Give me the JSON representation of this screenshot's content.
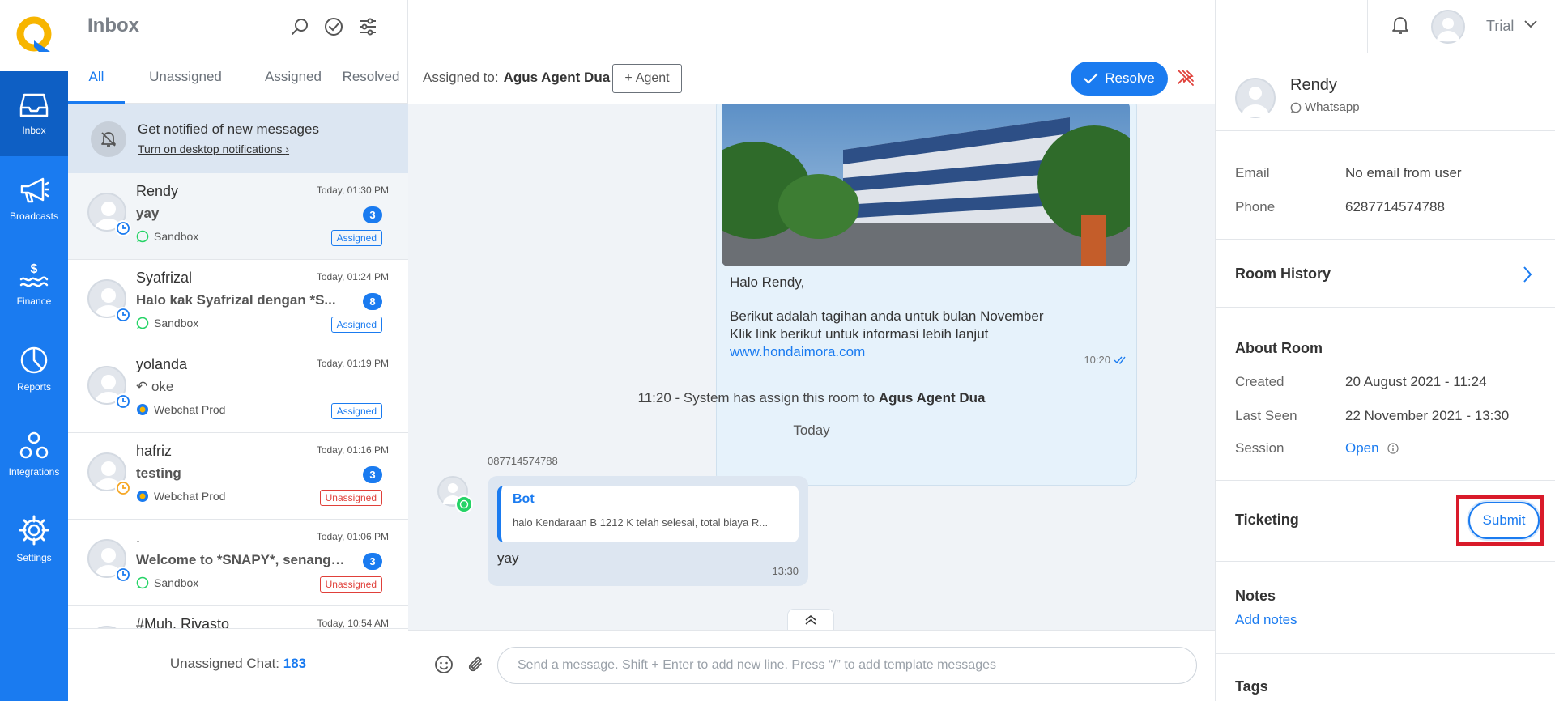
{
  "nav": {
    "items": [
      {
        "label": "Inbox",
        "icon": "inbox-icon"
      },
      {
        "label": "Broadcasts",
        "icon": "megaphone-icon"
      },
      {
        "label": "Finance",
        "icon": "finance-icon"
      },
      {
        "label": "Reports",
        "icon": "pie-chart-icon"
      },
      {
        "label": "Integrations",
        "icon": "integrations-icon"
      },
      {
        "label": "Settings",
        "icon": "gear-icon"
      }
    ],
    "colors": {
      "primary": "#1a7bf0",
      "active": "#0e5fc4",
      "logo_yellow": "#f7b500"
    }
  },
  "list": {
    "title": "Inbox",
    "tabs": [
      "All",
      "Unassigned",
      "Assigned",
      "Resolved"
    ],
    "active_tab": "All",
    "notification": {
      "title": "Get notified of new messages",
      "link": "Turn on desktop notifications"
    },
    "conversations": [
      {
        "name": "Rendy",
        "time": "Today, 01:30 PM",
        "message": "yay",
        "count": "3",
        "channel": "Sandbox",
        "channel_type": "whatsapp",
        "status": "Assigned",
        "clock_color": "#1a7bf0"
      },
      {
        "name": "Syafrizal",
        "time": "Today, 01:24 PM",
        "message": "Halo kak Syafrizal dengan *S...",
        "count": "8",
        "channel": "Sandbox",
        "channel_type": "whatsapp",
        "status": "Assigned",
        "clock_color": "#1a7bf0"
      },
      {
        "name": "yolanda",
        "time": "Today, 01:19 PM",
        "message": "oke",
        "count": "",
        "channel": "Webchat Prod",
        "channel_type": "webchat",
        "status": "Assigned",
        "clock_color": "#1a7bf0"
      },
      {
        "name": "hafriz",
        "time": "Today, 01:16 PM",
        "message": "testing",
        "count": "3",
        "channel": "Webchat Prod",
        "channel_type": "webchat",
        "status": "Unassigned",
        "clock_color": "#f5a623"
      },
      {
        "name": ".",
        "time": "Today, 01:06 PM",
        "message": "Welcome to *SNAPY*, senang d...",
        "count": "3",
        "channel": "Sandbox",
        "channel_type": "whatsapp",
        "status": "Unassigned",
        "clock_color": "#1a7bf0"
      },
      {
        "name": "#Muh. Rivasto",
        "time": "Today, 10:54 AM",
        "message": "",
        "count": "",
        "channel": "",
        "channel_type": "",
        "status": "",
        "clock_color": "#1a7bf0"
      }
    ],
    "footer_label": "Unassigned Chat:",
    "footer_count": "183"
  },
  "chat": {
    "assigned_label": "Assigned to:",
    "assigned_agent": "Agus Agent Dua",
    "agent_button": "Agent",
    "resolve_button": "Resolve",
    "outgoing": {
      "greeting": "Halo Rendy,",
      "line1": "Berikut adalah tagihan anda untuk bulan November",
      "line2": "Klik link berikut untuk informasi lebih lanjut",
      "link": "www.hondaimora.com",
      "time": "10:20"
    },
    "system_message": "11:20 - System has assign this room to",
    "system_agent": "Agus Agent Dua",
    "day_separator": "Today",
    "incoming": {
      "sender": "087714574788",
      "reply_title": "Bot",
      "reply_text": "halo Kendaraan B 1212 K telah selesai, total biaya R...",
      "text": "yay",
      "time": "13:30"
    },
    "composer_placeholder": "Send a message. Shift + Enter to add new line. Press “/” to add template messages"
  },
  "user": {
    "name": "Trial"
  },
  "contact": {
    "name": "Rendy",
    "channel": "Whatsapp",
    "email_label": "Email",
    "email_value": "No email from user",
    "phone_label": "Phone",
    "phone_value": "6287714574788"
  },
  "room_history": {
    "title": "Room History"
  },
  "about": {
    "title": "About Room",
    "created_label": "Created",
    "created_value": "20 August 2021 - 11:24",
    "last_seen_label": "Last Seen",
    "last_seen_value": "22 November 2021 - 13:30",
    "session_label": "Session",
    "session_value": "Open"
  },
  "ticketing": {
    "title": "Ticketing",
    "submit_button": "Submit"
  },
  "notes": {
    "title": "Notes",
    "add_link": "Add notes"
  },
  "tags": {
    "title": "Tags"
  }
}
